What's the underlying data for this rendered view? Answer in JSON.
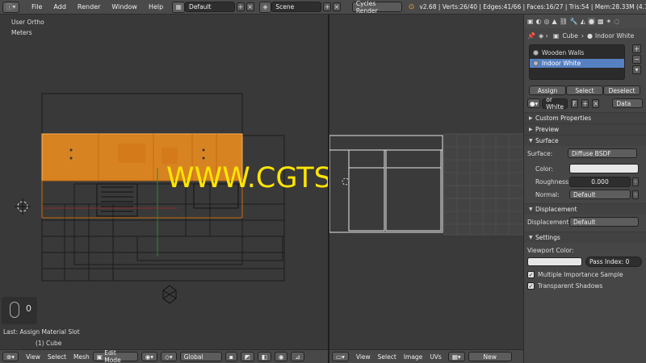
{
  "topbar": {
    "menu": [
      "File",
      "Add",
      "Render",
      "Window",
      "Help"
    ],
    "screen_layout": "Default",
    "scene": "Scene",
    "render_engine": "Cycles Render",
    "stats": "v2.68 | Verts:26/40 | Edges:41/66 | Faces:16/27 | Tris:54 | Mem:28.33M (4.73M) | Cube"
  },
  "viewport": {
    "view_name": "User Ortho",
    "units": "Meters",
    "last_op": "Last: Assign Material Slot",
    "object_label": "(1) Cube",
    "watermark": "WWW.CGTSJ.COM",
    "mouse_hint": "0"
  },
  "bottombar_3d": {
    "items": [
      "View",
      "Select",
      "Mesh"
    ],
    "mode": "Edit Mode",
    "orientation": "Global"
  },
  "bottombar_uv": {
    "items": [
      "View",
      "Select",
      "Image",
      "UVs"
    ],
    "new_label": "New"
  },
  "properties": {
    "breadcrumb_obj": "Cube",
    "breadcrumb_mat": "Indoor White",
    "slots": [
      "Wooden Walls",
      "Indoor White"
    ],
    "assign": "Assign",
    "select": "Select",
    "deselect": "Deselect",
    "mat_name": "or White",
    "mat_f": "F",
    "data_sel": "Data",
    "custom_props": "Custom Properties",
    "preview": "Preview",
    "surface": {
      "title": "Surface",
      "surface_label": "Surface:",
      "surface_value": "Diffuse BSDF",
      "color_label": "Color:",
      "color_value": "#e6e6e6",
      "roughness_label": "Roughness:",
      "roughness_value": "0.000",
      "normal_label": "Normal:",
      "normal_value": "Default"
    },
    "displacement": {
      "title": "Displacement",
      "label": "Displacement",
      "value": "Default"
    },
    "settings": {
      "title": "Settings",
      "viewport_color_label": "Viewport Color:",
      "pass_index": "Pass Index: 0",
      "mis_label": "Multiple Importance Sample",
      "ts_label": "Transparent Shadows"
    }
  },
  "colors": {
    "accent": "#f5901e",
    "selection_blue": "#5680c2",
    "watermark": "#ffe600"
  }
}
